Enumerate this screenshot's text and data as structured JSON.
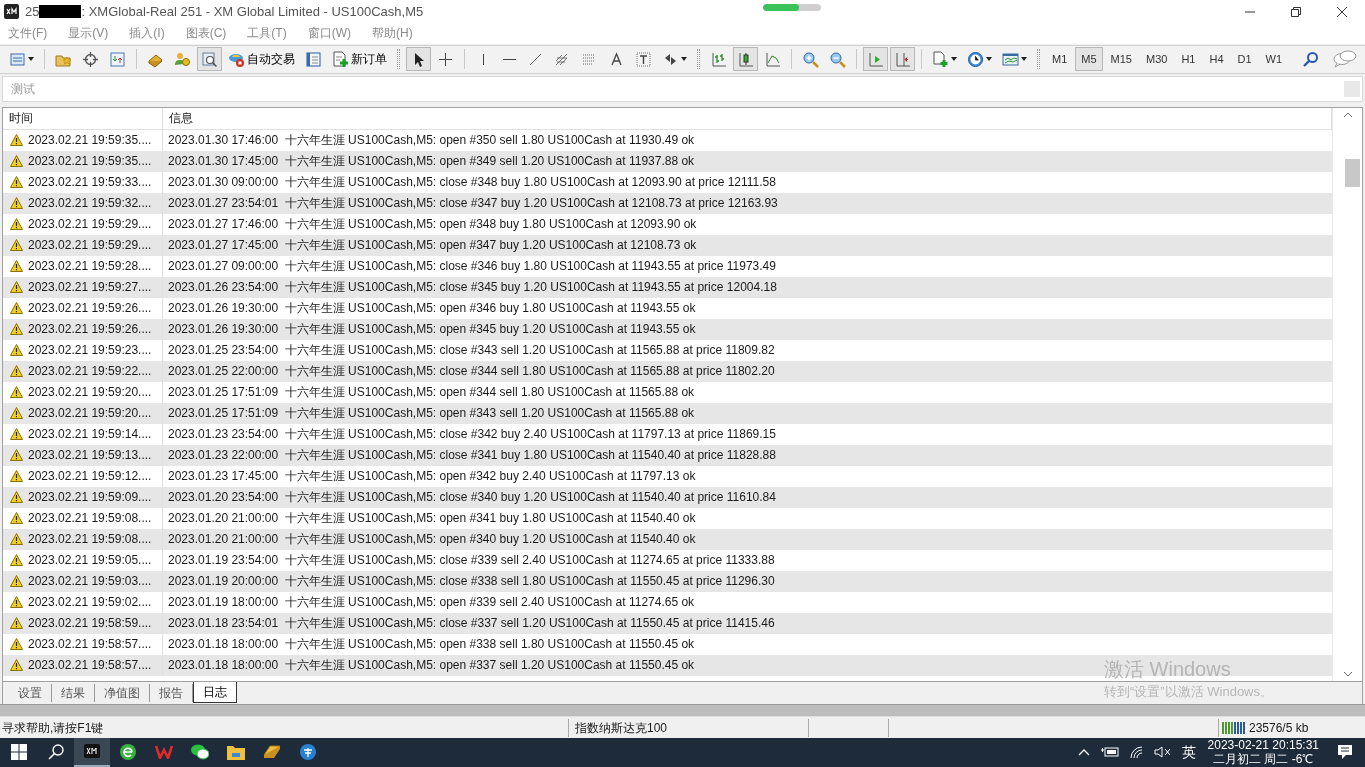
{
  "window": {
    "title_prefix": "25",
    "title": ": XMGlobal-Real 251 - XM Global Limited - US100Cash,M5"
  },
  "menu": [
    "文件(F)",
    "显示(V)",
    "插入(I)",
    "图表(C)",
    "工具(T)",
    "窗口(W)",
    "帮助(H)"
  ],
  "toolbar": {
    "auto_trading": "自动交易",
    "new_order": "新订单",
    "tools": [
      {
        "kind": "new-chart",
        "pressed": false
      },
      {
        "kind": "sep"
      },
      {
        "kind": "favorites",
        "pressed": false
      },
      {
        "kind": "target",
        "pressed": false
      },
      {
        "kind": "data-window",
        "pressed": false
      },
      {
        "kind": "sep"
      },
      {
        "kind": "book",
        "pressed": false
      },
      {
        "kind": "people",
        "pressed": false
      },
      {
        "kind": "tester",
        "pressed": true
      },
      {
        "kind": "auto-trading",
        "pressed": false
      },
      {
        "kind": "list",
        "pressed": false
      },
      {
        "kind": "new-order",
        "pressed": false
      },
      {
        "kind": "grip"
      },
      {
        "kind": "cursor",
        "pressed": true
      },
      {
        "kind": "crosshair",
        "pressed": false
      },
      {
        "kind": "sep"
      },
      {
        "kind": "vline",
        "pressed": false
      },
      {
        "kind": "hline",
        "pressed": false
      },
      {
        "kind": "trendline",
        "pressed": false
      },
      {
        "kind": "fibo-e",
        "pressed": false
      },
      {
        "kind": "fibo-f",
        "pressed": false
      },
      {
        "kind": "text-a",
        "pressed": false
      },
      {
        "kind": "text-t",
        "pressed": false
      },
      {
        "kind": "arrows",
        "pressed": false
      },
      {
        "kind": "grip"
      },
      {
        "kind": "bars",
        "pressed": false
      },
      {
        "kind": "candles",
        "pressed": true
      },
      {
        "kind": "line-chart",
        "pressed": false
      },
      {
        "kind": "sep"
      },
      {
        "kind": "zoom-in",
        "pressed": false
      },
      {
        "kind": "zoom-out",
        "pressed": false
      },
      {
        "kind": "sep"
      },
      {
        "kind": "autoscroll",
        "pressed": true
      },
      {
        "kind": "shift",
        "pressed": true
      },
      {
        "kind": "sep"
      },
      {
        "kind": "indicators",
        "pressed": false
      },
      {
        "kind": "clock",
        "pressed": false
      },
      {
        "kind": "templates",
        "pressed": false
      },
      {
        "kind": "grip"
      }
    ],
    "timeframes": [
      {
        "label": "M1",
        "selected": false
      },
      {
        "label": "M5",
        "selected": true
      },
      {
        "label": "M15",
        "selected": false
      },
      {
        "label": "M30",
        "selected": false
      },
      {
        "label": "H1",
        "selected": false
      },
      {
        "label": "H4",
        "selected": false
      },
      {
        "label": "D1",
        "selected": false
      },
      {
        "label": "W1",
        "selected": false
      }
    ]
  },
  "panel": {
    "title": "测试"
  },
  "table": {
    "columns": [
      "时间",
      "信息"
    ],
    "rows": [
      {
        "time": "2023.02.21 19:59:35....",
        "message": "2023.01.30 17:46:00  十六年生涯 US100Cash,M5: open #350 sell 1.80 US100Cash at 11930.49 ok"
      },
      {
        "time": "2023.02.21 19:59:35....",
        "message": "2023.01.30 17:45:00  十六年生涯 US100Cash,M5: open #349 sell 1.20 US100Cash at 11937.88 ok"
      },
      {
        "time": "2023.02.21 19:59:33....",
        "message": "2023.01.30 09:00:00  十六年生涯 US100Cash,M5: close #348 buy 1.80 US100Cash at 12093.90 at price 12111.58"
      },
      {
        "time": "2023.02.21 19:59:32....",
        "message": "2023.01.27 23:54:01  十六年生涯 US100Cash,M5: close #347 buy 1.20 US100Cash at 12108.73 at price 12163.93"
      },
      {
        "time": "2023.02.21 19:59:29....",
        "message": "2023.01.27 17:46:00  十六年生涯 US100Cash,M5: open #348 buy 1.80 US100Cash at 12093.90 ok"
      },
      {
        "time": "2023.02.21 19:59:29....",
        "message": "2023.01.27 17:45:00  十六年生涯 US100Cash,M5: open #347 buy 1.20 US100Cash at 12108.73 ok"
      },
      {
        "time": "2023.02.21 19:59:28....",
        "message": "2023.01.27 09:00:00  十六年生涯 US100Cash,M5: close #346 buy 1.80 US100Cash at 11943.55 at price 11973.49"
      },
      {
        "time": "2023.02.21 19:59:27....",
        "message": "2023.01.26 23:54:00  十六年生涯 US100Cash,M5: close #345 buy 1.20 US100Cash at 11943.55 at price 12004.18"
      },
      {
        "time": "2023.02.21 19:59:26....",
        "message": "2023.01.26 19:30:00  十六年生涯 US100Cash,M5: open #346 buy 1.80 US100Cash at 11943.55 ok"
      },
      {
        "time": "2023.02.21 19:59:26....",
        "message": "2023.01.26 19:30:00  十六年生涯 US100Cash,M5: open #345 buy 1.20 US100Cash at 11943.55 ok"
      },
      {
        "time": "2023.02.21 19:59:23....",
        "message": "2023.01.25 23:54:00  十六年生涯 US100Cash,M5: close #343 sell 1.20 US100Cash at 11565.88 at price 11809.82"
      },
      {
        "time": "2023.02.21 19:59:22....",
        "message": "2023.01.25 22:00:00  十六年生涯 US100Cash,M5: close #344 sell 1.80 US100Cash at 11565.88 at price 11802.20"
      },
      {
        "time": "2023.02.21 19:59:20....",
        "message": "2023.01.25 17:51:09  十六年生涯 US100Cash,M5: open #344 sell 1.80 US100Cash at 11565.88 ok"
      },
      {
        "time": "2023.02.21 19:59:20....",
        "message": "2023.01.25 17:51:09  十六年生涯 US100Cash,M5: open #343 sell 1.20 US100Cash at 11565.88 ok"
      },
      {
        "time": "2023.02.21 19:59:14....",
        "message": "2023.01.23 23:54:00  十六年生涯 US100Cash,M5: close #342 buy 2.40 US100Cash at 11797.13 at price 11869.15"
      },
      {
        "time": "2023.02.21 19:59:13....",
        "message": "2023.01.23 22:00:00  十六年生涯 US100Cash,M5: close #341 buy 1.80 US100Cash at 11540.40 at price 11828.88"
      },
      {
        "time": "2023.02.21 19:59:12....",
        "message": "2023.01.23 17:45:00  十六年生涯 US100Cash,M5: open #342 buy 2.40 US100Cash at 11797.13 ok"
      },
      {
        "time": "2023.02.21 19:59:09....",
        "message": "2023.01.20 23:54:00  十六年生涯 US100Cash,M5: close #340 buy 1.20 US100Cash at 11540.40 at price 11610.84"
      },
      {
        "time": "2023.02.21 19:59:08....",
        "message": "2023.01.20 21:00:00  十六年生涯 US100Cash,M5: open #341 buy 1.80 US100Cash at 11540.40 ok"
      },
      {
        "time": "2023.02.21 19:59:08....",
        "message": "2023.01.20 21:00:00  十六年生涯 US100Cash,M5: open #340 buy 1.20 US100Cash at 11540.40 ok"
      },
      {
        "time": "2023.02.21 19:59:05....",
        "message": "2023.01.19 23:54:00  十六年生涯 US100Cash,M5: close #339 sell 2.40 US100Cash at 11274.65 at price 11333.88"
      },
      {
        "time": "2023.02.21 19:59:03....",
        "message": "2023.01.19 20:00:00  十六年生涯 US100Cash,M5: close #338 sell 1.80 US100Cash at 11550.45 at price 11296.30"
      },
      {
        "time": "2023.02.21 19:59:02....",
        "message": "2023.01.19 18:00:00  十六年生涯 US100Cash,M5: open #339 sell 2.40 US100Cash at 11274.65 ok"
      },
      {
        "time": "2023.02.21 19:58:59....",
        "message": "2023.01.18 23:54:01  十六年生涯 US100Cash,M5: close #337 sell 1.20 US100Cash at 11550.45 at price 11415.46"
      },
      {
        "time": "2023.02.21 19:58:57....",
        "message": "2023.01.18 18:00:00  十六年生涯 US100Cash,M5: open #338 sell 1.80 US100Cash at 11550.45 ok"
      },
      {
        "time": "2023.02.21 19:58:57....",
        "message": "2023.01.18 18:00:00  十六年生涯 US100Cash,M5: open #337 sell 1.20 US100Cash at 11550.45 ok"
      }
    ]
  },
  "bottom_tabs": [
    {
      "label": "设置",
      "selected": false
    },
    {
      "label": "结果",
      "selected": false
    },
    {
      "label": "净值图",
      "selected": false
    },
    {
      "label": "报告",
      "selected": false
    },
    {
      "label": "日志",
      "selected": true
    }
  ],
  "activation_notice": {
    "title": "激活 Windows",
    "hint": "转到“设置”以激活 Windows。"
  },
  "status_bar": {
    "help": "寻求帮助,请按F1键",
    "symbol": "指数纳斯达克100",
    "traffic": "23576/5 kb"
  },
  "taskbar": {
    "input_method": "英",
    "time": "2023-02-21 20:15:31",
    "date": "二月初二 周二 -6℃"
  }
}
